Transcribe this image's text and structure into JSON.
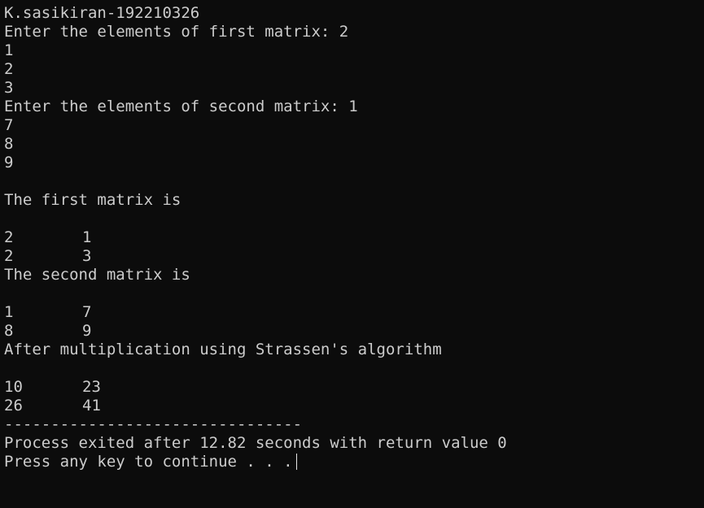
{
  "console": {
    "header": "K.sasikiran-192210326",
    "prompt_first": "Enter the elements of first matrix: 2",
    "first_inputs": [
      "1",
      "2",
      "3"
    ],
    "prompt_second": "Enter the elements of second matrix: 1",
    "second_inputs": [
      "7",
      "8",
      "9"
    ],
    "first_label": "The first matrix is",
    "first_matrix": [
      [
        "2",
        "1"
      ],
      [
        "2",
        "3"
      ]
    ],
    "second_label": "The second matrix is",
    "second_matrix": [
      [
        "1",
        "7"
      ],
      [
        "8",
        "9"
      ]
    ],
    "result_label": "After multiplication using Strassen's algorithm",
    "result_matrix": [
      [
        "10",
        "23"
      ],
      [
        "26",
        "41"
      ]
    ],
    "separator": "--------------------------------",
    "exit_message": "Process exited after 12.82 seconds with return value 0",
    "continue_prompt": "Press any key to continue . . ."
  }
}
